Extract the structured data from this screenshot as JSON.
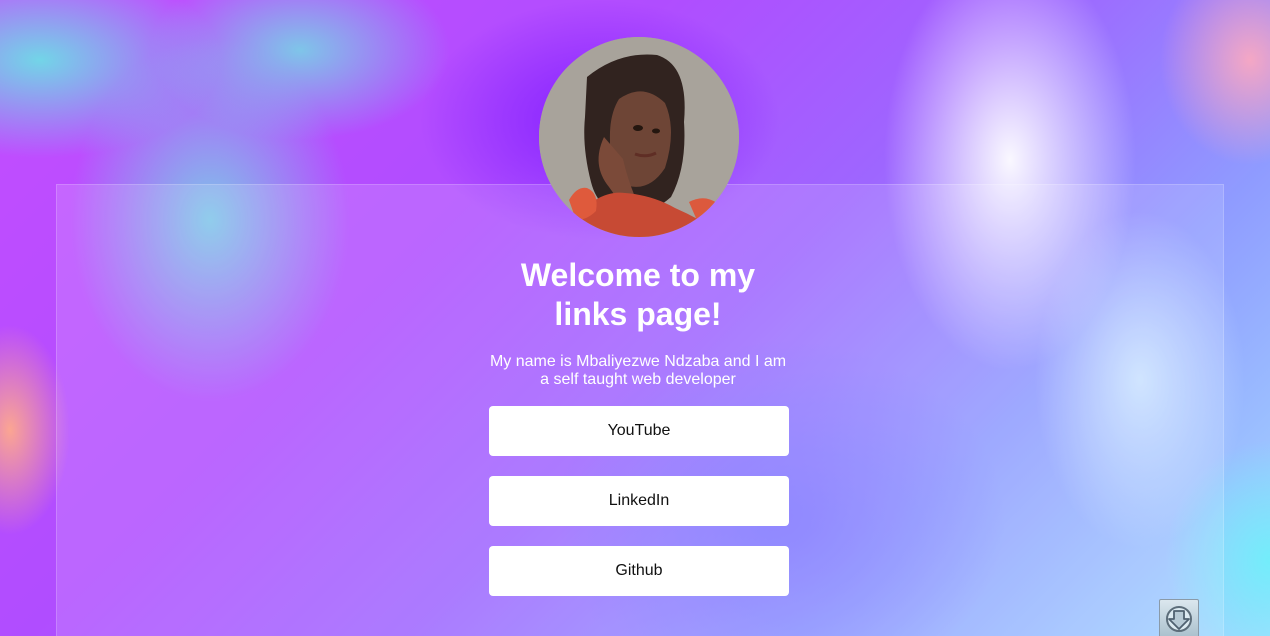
{
  "profile": {
    "avatar_alt": "Profile photo of Mbaliyezwe Ndzaba"
  },
  "header": {
    "title_line1": "Welcome to my",
    "title_line2": "links page!",
    "intro_line1": "My name is Mbaliyezwe Ndzaba and I am",
    "intro_line2": "a self taught web developer"
  },
  "links": [
    {
      "label": "YouTube"
    },
    {
      "label": "LinkedIn"
    },
    {
      "label": "Github"
    }
  ],
  "widgets": {
    "download_icon": "download-arrow-icon"
  },
  "colors": {
    "background_primary": "#c44dff",
    "background_secondary": "#9e66ff",
    "background_accent": "#a5dcff",
    "text": "#ffffff",
    "button_bg": "#ffffff",
    "button_text": "#111111"
  }
}
